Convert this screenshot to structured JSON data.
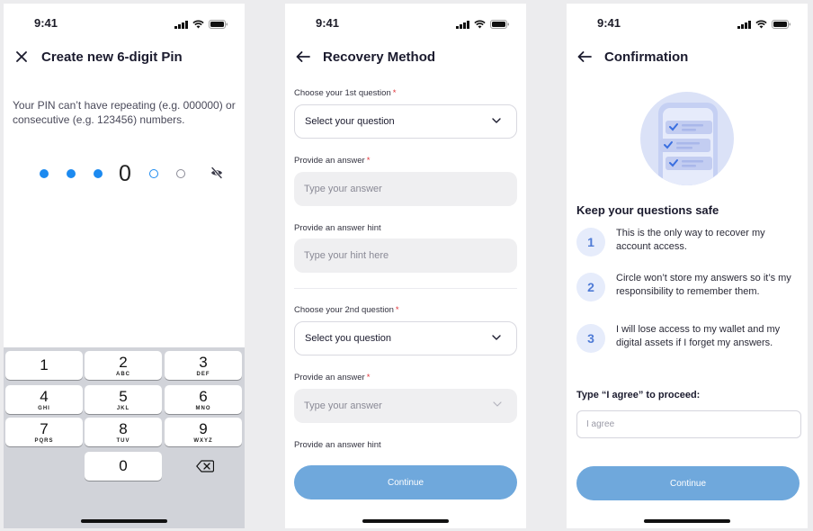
{
  "status": {
    "time": "9:41"
  },
  "screen1": {
    "title": "Create new 6-digit Pin",
    "description": "Your PIN can’t have repeating (e.g. 000000) or consecutive (e.g. 123456) numbers.",
    "pin_visible_digit": "0",
    "keypad": [
      {
        "num": "1",
        "letters": ""
      },
      {
        "num": "2",
        "letters": "ABC"
      },
      {
        "num": "3",
        "letters": "DEF"
      },
      {
        "num": "4",
        "letters": "GHI"
      },
      {
        "num": "5",
        "letters": "JKL"
      },
      {
        "num": "6",
        "letters": "MNO"
      },
      {
        "num": "7",
        "letters": "PQRS"
      },
      {
        "num": "8",
        "letters": "TUV"
      },
      {
        "num": "9",
        "letters": "WXYZ"
      },
      {
        "num": "0",
        "letters": ""
      }
    ]
  },
  "screen2": {
    "title": "Recovery Method",
    "q1_label": "Choose your 1st question",
    "q1_value": "Select your question",
    "a1_label": "Provide an answer",
    "a1_placeholder": "Type your answer",
    "h1_label": "Provide an answer hint",
    "h1_placeholder": "Type your hint here",
    "q2_label": "Choose your 2nd question",
    "q2_value": "Select you question",
    "a2_label": "Provide an answer",
    "a2_placeholder": "Type your answer",
    "h2_label": "Provide an answer hint",
    "required_mark": "*",
    "continue_label": "Continue"
  },
  "screen3": {
    "title": "Confirmation",
    "heading": "Keep your questions safe",
    "steps": [
      {
        "num": "1",
        "text": "This is the only way to recover my account access."
      },
      {
        "num": "2",
        "text": "Circle won’t store my answers so it’s my responsibility to remember them."
      },
      {
        "num": "3",
        "text": "I will lose access to my wallet and my digital assets if I forget my answers."
      }
    ],
    "agree_label": "Type “I agree” to proceed:",
    "agree_placeholder": "I agree",
    "continue_label": "Continue"
  },
  "colors": {
    "accent": "#1c8af0",
    "button_disabled": "#6fa8dc",
    "required": "#e0343a"
  }
}
